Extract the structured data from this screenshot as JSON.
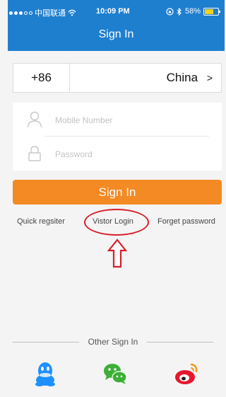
{
  "status_bar": {
    "carrier": "中国联通",
    "time": "10:09 PM",
    "battery": "58%"
  },
  "header": {
    "title": "Sign In"
  },
  "country_selector": {
    "code": "+86",
    "country": "China",
    "chevron": ">"
  },
  "form": {
    "mobile_placeholder": "Mobile Number",
    "password_placeholder": "Password"
  },
  "buttons": {
    "sign_in": "Sign In"
  },
  "links": {
    "quick_register": "Quick regsiter",
    "visitor_login": "Vistor Login",
    "forget_password": "Forget password"
  },
  "other_sign_in": {
    "label": "Other Sign In"
  },
  "icons": {
    "mobile": "person-icon",
    "password": "lock-icon",
    "qq": "qq-icon",
    "wechat": "wechat-icon",
    "weibo": "weibo-icon",
    "annotation_arrow": "up-arrow-icon"
  },
  "colors": {
    "header": "#1f7fcf",
    "sign_in_button": "#f48a24",
    "annotation": "#d81f2a",
    "qq": "#1e90ff",
    "wechat": "#3cb035",
    "weibo": "#e6162d"
  }
}
